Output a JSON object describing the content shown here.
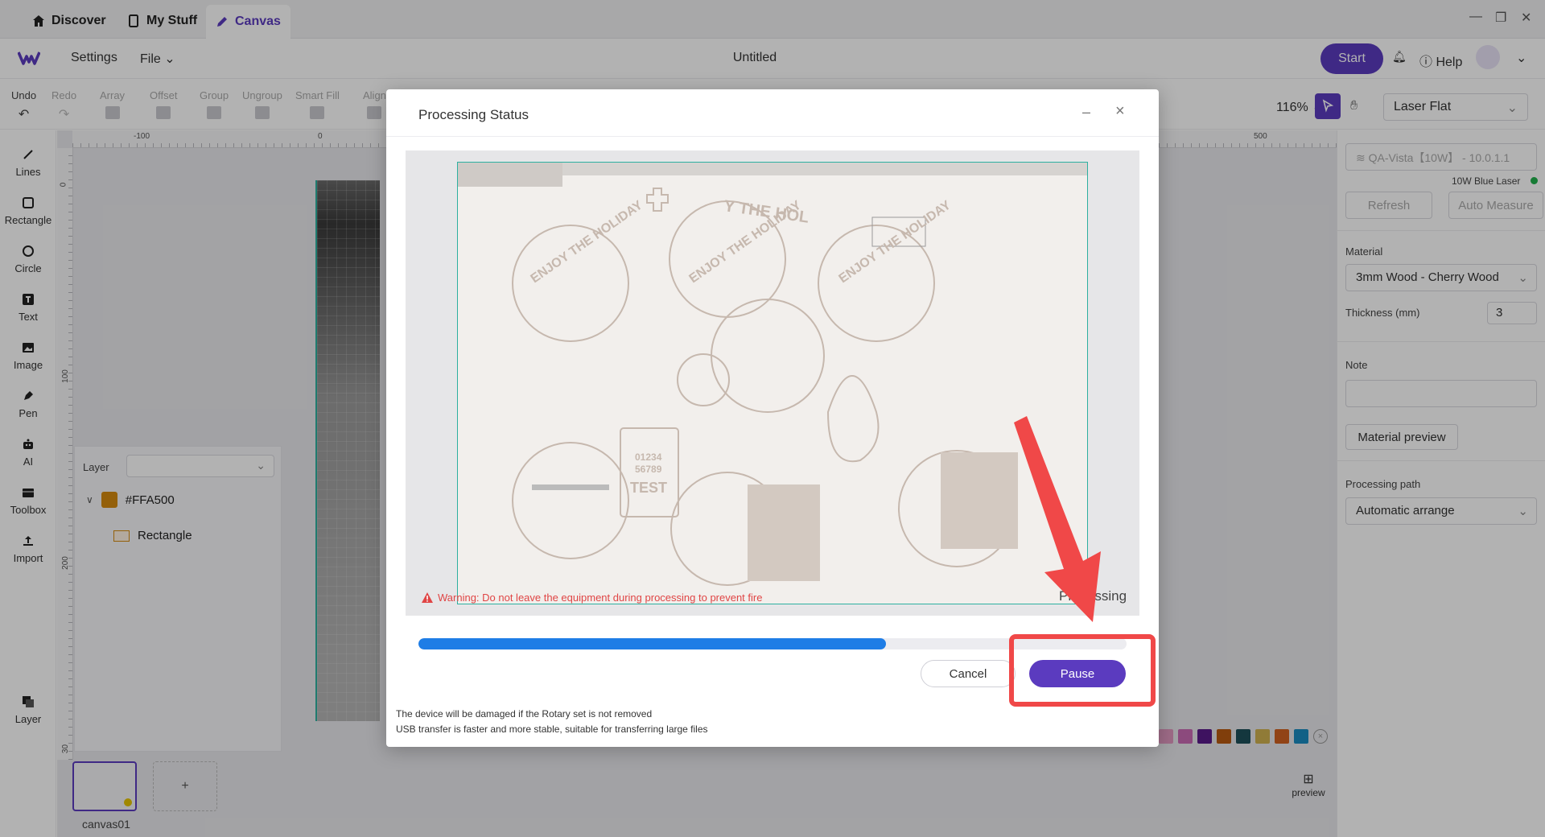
{
  "tabs": [
    {
      "label": "Discover",
      "icon": "home-icon"
    },
    {
      "label": "My Stuff",
      "icon": "tablet-icon"
    },
    {
      "label": "Canvas",
      "icon": "pen-icon"
    }
  ],
  "header": {
    "settings": "Settings",
    "file": "File",
    "title": "Untitled",
    "start": "Start",
    "help": "Help"
  },
  "toolbar": {
    "undo": "Undo",
    "redo": "Redo",
    "array": "Array",
    "offset": "Offset",
    "group": "Group",
    "ungroup": "Ungroup",
    "smart_fill": "Smart Fill",
    "align": "Align",
    "zoom": "116%",
    "mode": "Laser Flat"
  },
  "left_tools": [
    "Lines",
    "Rectangle",
    "Circle",
    "Text",
    "Image",
    "Pen",
    "AI",
    "Toolbox",
    "Import",
    "Layer"
  ],
  "rulers": {
    "top": [
      "-100",
      "0",
      "500"
    ],
    "left": [
      "0",
      "100",
      "200",
      "30"
    ]
  },
  "layer_panel": {
    "label": "Layer",
    "group": "#FFA500",
    "item": "Rectangle"
  },
  "canvas_thumb": {
    "label": "canvas01",
    "add": "+"
  },
  "preview_label": "preview",
  "right_panel": {
    "device": "QA-Vista【10W】 - 10.0.1.1",
    "laser": "10W Blue Laser",
    "refresh": "Refresh",
    "auto_measure": "Auto Measure",
    "material_label": "Material",
    "material": "3mm Wood - Cherry Wood",
    "thickness_label": "Thickness (mm)",
    "thickness": "3",
    "note_label": "Note",
    "material_preview": "Material preview",
    "path_label": "Processing path",
    "path": "Automatic arrange"
  },
  "swatch_colors": [
    "#e39ac2",
    "#c96bb4",
    "#5a1b8a",
    "#b85a10",
    "#1e4f5a",
    "#cfb050",
    "#d06020",
    "#1a8cc0"
  ],
  "modal": {
    "title": "Processing Status",
    "warning": "Warning: Do not leave the equipment during processing to prevent fire",
    "status": "Processing",
    "progress": 0.66,
    "cancel": "Cancel",
    "pause": "Pause",
    "note1": "The device will be damaged if the Rotary set is not removed",
    "note2": "USB transfer is faster and more stable, suitable for transferring large files",
    "photo_text": [
      "Y THE HOL",
      "ENJOY THE HOLIDAY",
      "ENJOY THE HOLIDAY",
      "ENJOY THE HOLIDAY",
      "01234",
      "56789",
      "TEST"
    ]
  },
  "colors": {
    "accent": "#5b3bbf",
    "progress": "#1e7de6",
    "highlight": "#f04848",
    "warning": "#e04545"
  }
}
